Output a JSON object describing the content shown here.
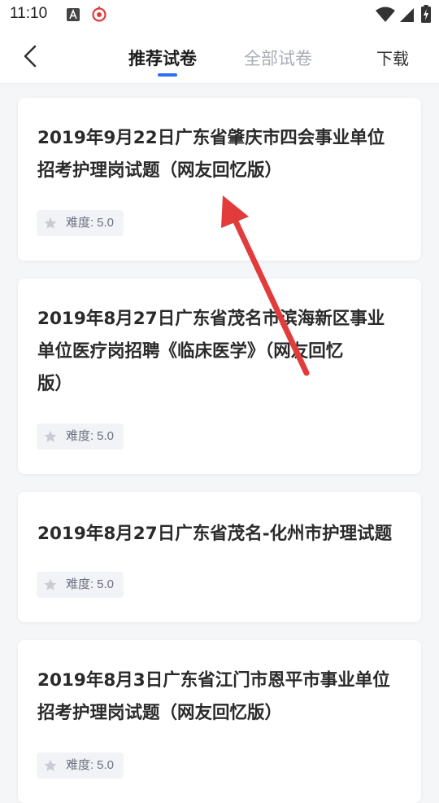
{
  "status_bar": {
    "time": "11:10",
    "icons": [
      "a-icon",
      "target-icon",
      "wifi-icon",
      "signal-icon",
      "battery-icon"
    ]
  },
  "nav": {
    "tabs": [
      {
        "label": "推荐试卷",
        "active": true
      },
      {
        "label": "全部试卷",
        "active": false
      }
    ],
    "download_label": "下载",
    "accent_color": "#2f6ef6"
  },
  "papers": [
    {
      "title_lines": [
        "2019年9月22日广东省肇庆市四会事业单位",
        "招考护理岗试题（网友回忆版）"
      ],
      "difficulty_label": "难度:",
      "difficulty_value": "5.0"
    },
    {
      "title_lines": [
        "2019年8月27日广东省茂名市滨海新区事业",
        "单位医疗岗招聘《临床医学》（网友回忆",
        "版）"
      ],
      "difficulty_label": "难度:",
      "difficulty_value": "5.0"
    },
    {
      "title_lines": [
        "2019年8月27日广东省茂名-化州市护理试题"
      ],
      "difficulty_label": "难度:",
      "difficulty_value": "5.0"
    },
    {
      "title_lines": [
        "2019年8月3日广东省江门市恩平市事业单位",
        "招考护理岗试题（网友回忆版）"
      ],
      "difficulty_label": "难度:",
      "difficulty_value": "5.0"
    }
  ],
  "annotation": {
    "type": "red-arrow-icon",
    "color": "#e23b3b"
  }
}
